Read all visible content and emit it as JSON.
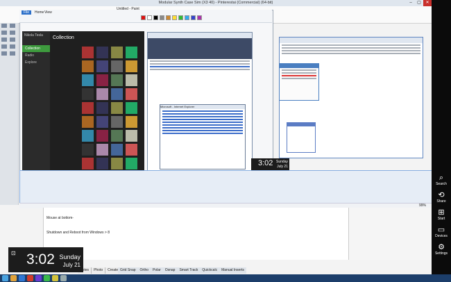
{
  "window": {
    "title": "Modular Synth Case Sim (X3 40) - Pinterestai (Commercial) (64-bit)"
  },
  "paint": {
    "file_tab": "File",
    "home_tab": "Home",
    "view_tab": "View",
    "title": "Untitled - Paint"
  },
  "music": {
    "header": "Collection",
    "nav": [
      "Collection",
      "Radio",
      "Explore"
    ],
    "user": "Nikola Tesla"
  },
  "browser": {
    "label": "Microsoft - Internet Explorer"
  },
  "doc": {
    "para1": "Mouse at bottom-",
    "para2": "Shutdown and Reboot from Windows > 8"
  },
  "clock_big": {
    "time": "3:02",
    "day": "Sunday",
    "date": "July 21"
  },
  "clock_small": {
    "time": "3:02",
    "day": "Sunday",
    "date": "July 21"
  },
  "charms": [
    {
      "icon": "search-icon",
      "label": "Search"
    },
    {
      "icon": "share-icon",
      "label": "Share"
    },
    {
      "icon": "windows-start-icon",
      "label": "Start"
    },
    {
      "icon": "devices-icon",
      "label": "Devices"
    },
    {
      "icon": "settings-icon",
      "label": "Settings"
    }
  ],
  "bottom_tabs": [
    "Notes",
    "Photo",
    "Create"
  ],
  "tabs_bottom2": [
    "Grid Snap",
    "Ortho",
    "Polar",
    "Osnap",
    "Smart Track",
    "Quickcalc",
    "Manual Inserts"
  ],
  "status": {
    "zoom": "99%"
  },
  "colors": {
    "charms_bg": "#0b0b0b",
    "taskbar": "#1c3e6a",
    "accent": "#3e9b3e"
  }
}
